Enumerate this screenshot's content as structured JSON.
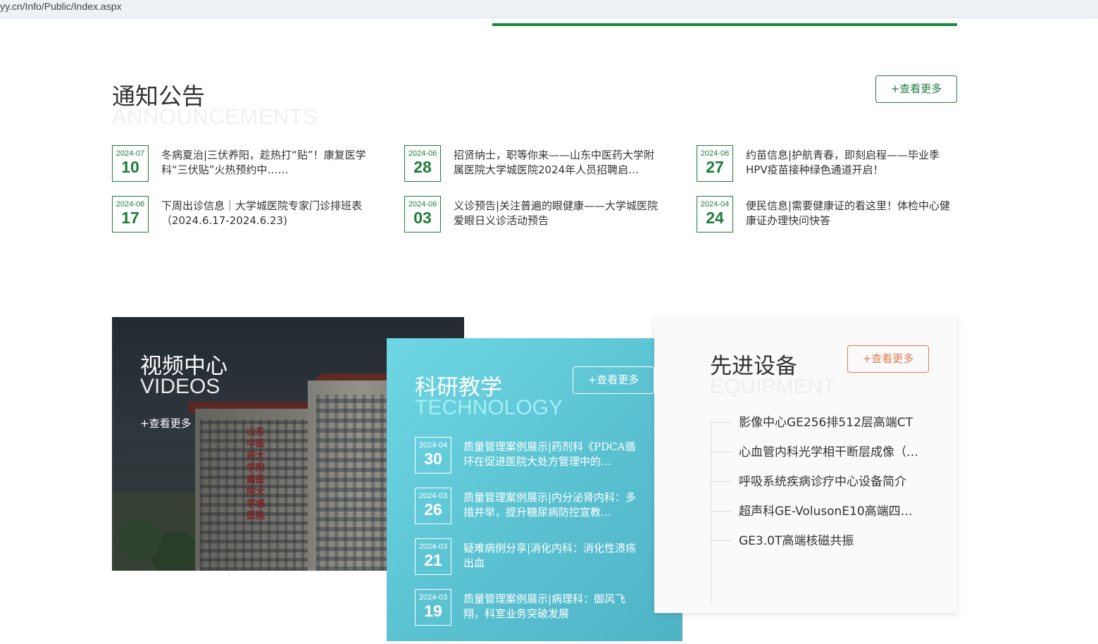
{
  "browser": {
    "url": "yy.cn/Info/Public/Index.aspx"
  },
  "announcements": {
    "title": "通知公告",
    "subtitle": "ANNOUNCEMENTS",
    "more_label": "+查看更多",
    "items": [
      {
        "ym": "2024-07",
        "day": "10",
        "text": "冬病夏治|三伏养阳，趁热打“贴”！康复医学科“三伏贴”火热预约中……"
      },
      {
        "ym": "2024-06",
        "day": "28",
        "text": "招贤纳士，职等你来——山东中医药大学附属医院大学城医院2024年人员招聘启…"
      },
      {
        "ym": "2024-06",
        "day": "27",
        "text": "约苗信息|护航青春，即刻启程——毕业季HPV疫苗接种绿色通道开启！"
      },
      {
        "ym": "2024-06",
        "day": "17",
        "text": "下周出诊信息｜大学城医院专家门诊排班表（2024.6.17-2024.6.23)"
      },
      {
        "ym": "2024-06",
        "day": "03",
        "text": "义诊预告|关注普遍的眼健康——大学城医院爱眼日义诊活动预告"
      },
      {
        "ym": "2024-04",
        "day": "24",
        "text": "便民信息|需要健康证的看这里！体检中心健康证办理快问快答"
      }
    ]
  },
  "videos": {
    "title": "视频中心",
    "subtitle": "VIDEOS",
    "more_label": "+查看更多",
    "building_sign": "山东中医药大学附属医院大学城医院"
  },
  "research": {
    "title": "科研教学",
    "subtitle": "TECHNOLOGY",
    "more_label": "+查看更多",
    "items": [
      {
        "ym": "2024-04",
        "day": "30",
        "text": "质量管理案例展示|药剂科《PDCA循环在促进医院大处方管理中的…"
      },
      {
        "ym": "2024-03",
        "day": "26",
        "text": "质量管理案例展示|内分泌肾内科：多措并举，提升糖尿病防控宣教…"
      },
      {
        "ym": "2024-03",
        "day": "21",
        "text": "疑难病例分享|消化内科：消化性溃疡出血"
      },
      {
        "ym": "2024-03",
        "day": "19",
        "text": "质量管理案例展示|病理科：御风飞翔，科室业务突破发展"
      }
    ]
  },
  "equipment": {
    "title": "先进设备",
    "subtitle": "EQUIPMENT",
    "more_label": "+查看更多",
    "items": [
      "影像中心GE256排512层高端CT",
      "心血管内科光学相干断层成像（…",
      "呼吸系统疾病诊疗中心设备简介",
      "超声科GE-VolusonE10高端四…",
      "GE3.0T高端核磁共振"
    ]
  },
  "colors": {
    "accent_green": "#1e7d3b",
    "research_bg": "#5cc3d3",
    "equip_orange": "#e07b4f"
  }
}
